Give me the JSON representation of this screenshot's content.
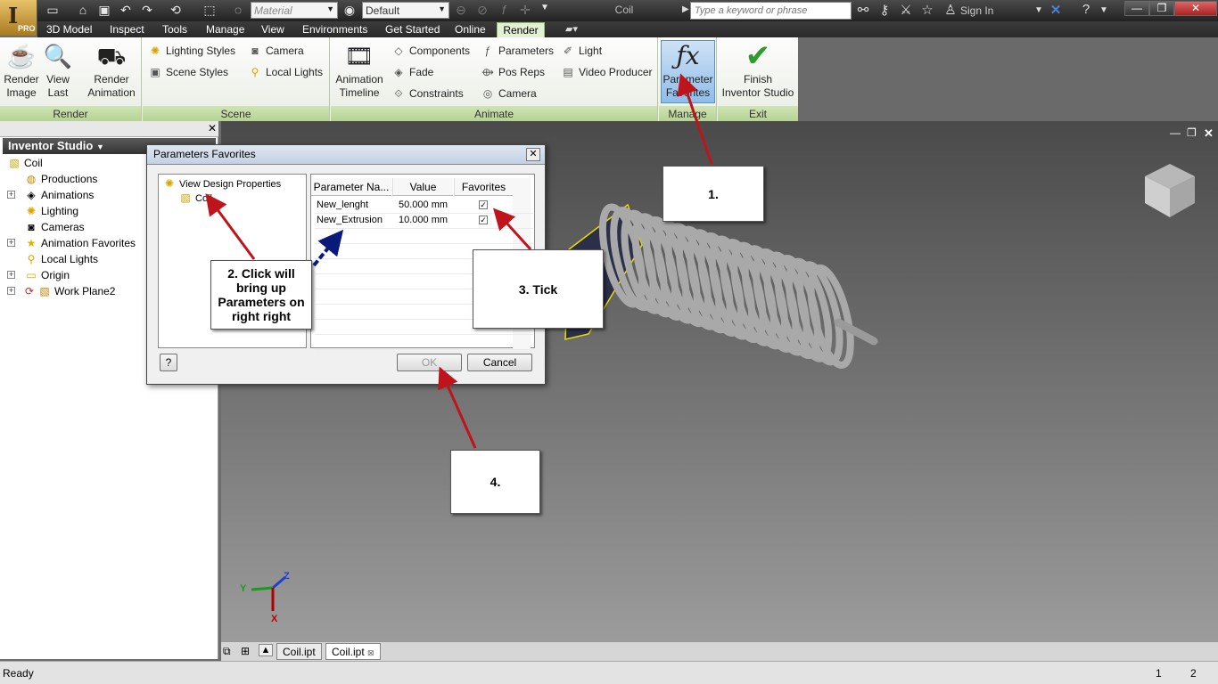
{
  "app": {
    "badge": "PRO",
    "document_title": "Coil"
  },
  "toolbar": {
    "material": "Material",
    "appearance": "Default",
    "search_placeholder": "Type a keyword or phrase",
    "sign_in": "Sign In"
  },
  "tabs": [
    "3D Model",
    "Inspect",
    "Tools",
    "Manage",
    "View",
    "Environments",
    "Get Started",
    "Online",
    "Render"
  ],
  "ribbon": {
    "render_group": {
      "label": "Render",
      "render_image": "Render\nImage",
      "view_last": "View\nLast",
      "render_animation": "Render\nAnimation"
    },
    "scene_group": {
      "label": "Scene",
      "lighting_styles": "Lighting Styles",
      "scene_styles": "Scene Styles",
      "camera": "Camera",
      "local_lights": "Local Lights"
    },
    "animate_group": {
      "label": "Animate",
      "animation_timeline": "Animation\nTimeline",
      "components": "Components",
      "fade": "Fade",
      "constraints": "Constraints",
      "parameters": "Parameters",
      "pos_reps": "Pos Reps",
      "camera": "Camera",
      "light": "Light",
      "video_producer": "Video Producer"
    },
    "manage_group": {
      "label": "Manage",
      "parameter_favorites": "Parameter\nFavorites"
    },
    "exit_group": {
      "label": "Exit",
      "finish": "Finish\nInventor Studio"
    }
  },
  "browser": {
    "title": "Inventor Studio",
    "items": [
      "Coil",
      "Productions",
      "Animations",
      "Lighting",
      "Cameras",
      "Animation Favorites",
      "Local Lights",
      "Origin",
      "Work Plane2"
    ]
  },
  "dialog": {
    "title": "Parameters Favorites",
    "tree_root": "View Design Properties",
    "tree_child": "Coil",
    "columns": [
      "Parameter Na...",
      "Value",
      "Favorites"
    ],
    "rows": [
      {
        "name": "New_lenght",
        "value": "50.000 mm",
        "favorite": "✓"
      },
      {
        "name": "New_Extrusion",
        "value": "10.000 mm",
        "favorite": "✓"
      }
    ],
    "ok": "OK",
    "cancel": "Cancel"
  },
  "callouts": {
    "c1": "1.",
    "c2": "2. Click will bring up Parameters on right right",
    "c3": "3. Tick",
    "c4": "4."
  },
  "doc_tabs": [
    "Coil.ipt",
    "Coil.ipt"
  ],
  "status": {
    "text": "Ready",
    "n1": "1",
    "n2": "2"
  },
  "axes": {
    "x": "X",
    "y": "Y",
    "z": "Z"
  },
  "colors": {
    "ribbon_group": "#b6d293",
    "arrow_red": "#c0141c",
    "arrow_blue": "#0a1a7a"
  }
}
